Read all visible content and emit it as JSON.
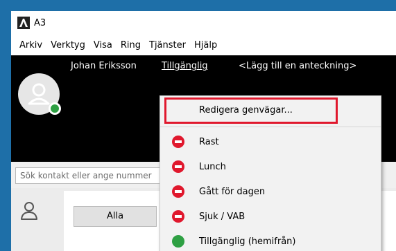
{
  "window": {
    "title": "A3"
  },
  "menubar": {
    "items": [
      {
        "label": "Arkiv"
      },
      {
        "label": "Verktyg"
      },
      {
        "label": "Visa"
      },
      {
        "label": "Ring"
      },
      {
        "label": "Tjänster"
      },
      {
        "label": "Hjälp"
      }
    ]
  },
  "header": {
    "user_name": "Johan Eriksson",
    "status": "Tillgänglig",
    "note_placeholder": "<Lägg till en anteckning>"
  },
  "search": {
    "placeholder": "Sök kontakt eller ange nummer"
  },
  "tabs": {
    "all_label": "Alla"
  },
  "context_menu": {
    "edit_shortcuts": "Redigera genvägar...",
    "items": [
      {
        "label": "Rast",
        "status": "busy"
      },
      {
        "label": "Lunch",
        "status": "busy"
      },
      {
        "label": "Gått för dagen",
        "status": "busy"
      },
      {
        "label": "Sjuk / VAB",
        "status": "busy"
      },
      {
        "label": "Tillgänglig (hemifrån)",
        "status": "available"
      }
    ]
  },
  "colors": {
    "header_bg": "#000000",
    "busy_red": "#e0182d",
    "available_green": "#2ea043",
    "highlight": "#e0182d"
  }
}
